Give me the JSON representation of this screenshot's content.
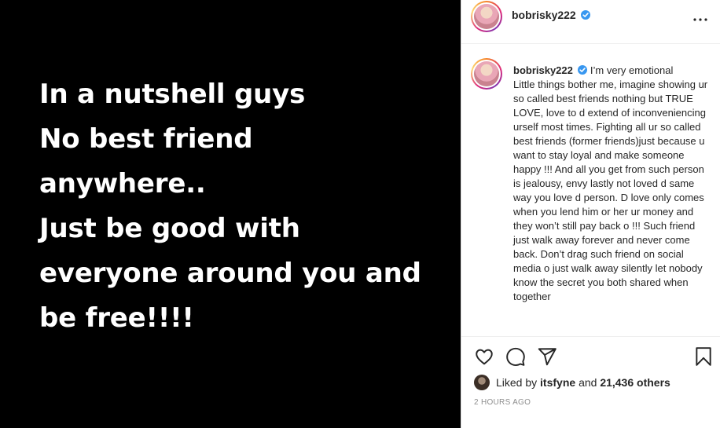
{
  "post_image": {
    "lines": [
      "In a nutshell guys",
      "No best friend",
      "anywhere..",
      "Just be good with",
      "everyone around you and",
      "be free!!!!"
    ],
    "background": "#000000",
    "text_color": "#ffffff"
  },
  "header": {
    "username": "bobrisky222",
    "verified_icon": "verified-badge-icon",
    "more_icon": "more-options-icon"
  },
  "caption": {
    "username": "bobrisky222",
    "text": "I’m very emotional\nLittle things bother me, imagine showing ur so called best friends nothing but TRUE LOVE, love to d extend of inconveniencing urself most times. Fighting all ur so called best friends (former friends)just because u want to stay loyal and make someone happy !!! And all you get from such person is jealousy, envy lastly not loved d same way you love d person. D love only comes when you lend him or her ur money and they won’t still pay back o !!! Such friend just walk away forever and never come back. Don’t drag such friend on social media o just walk away silently let nobody know the secret you both shared when together"
  },
  "actions": {
    "like_icon": "heart-icon",
    "comment_icon": "comment-icon",
    "share_icon": "share-icon",
    "save_icon": "bookmark-icon"
  },
  "likes": {
    "prefix": "Liked by",
    "user": "itsfyne",
    "connector": "and",
    "count": "21,436 others"
  },
  "timestamp": "2 HOURS AGO",
  "colors": {
    "verified": "#3897f0",
    "text": "#262626",
    "muted": "#8e8e8e",
    "border": "#dbdbdb"
  }
}
